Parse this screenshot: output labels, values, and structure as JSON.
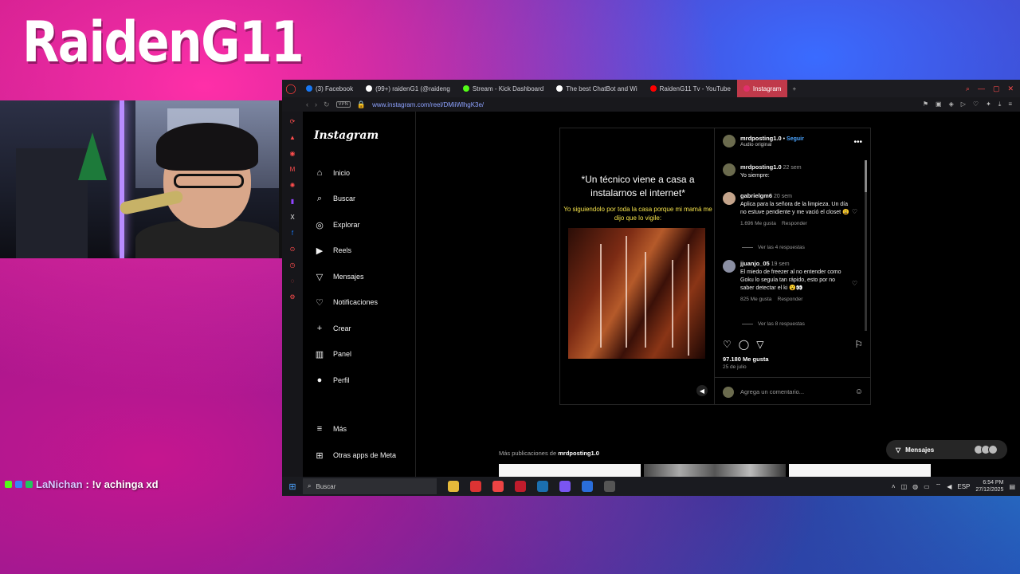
{
  "stream": {
    "title": "RaidenG11",
    "chat": {
      "user": "LaNichan",
      "message": ": !v achinga xd"
    }
  },
  "browser": {
    "tabs": [
      {
        "label": "(3) Facebook",
        "color": "#1877f2"
      },
      {
        "label": "(99+) raidenG1 (@raideng",
        "color": "#ffffff"
      },
      {
        "label": "Stream - Kick Dashboard",
        "color": "#53fc18"
      },
      {
        "label": "The best ChatBot and Wi",
        "color": "#ffffff"
      },
      {
        "label": "RaidenG11 Tv - YouTube",
        "color": "#ff0000"
      },
      {
        "label": "Instagram",
        "color": "#e1306c"
      }
    ],
    "address": {
      "vpn": "VPN",
      "url": "www.instagram.com/reel/DMiiWlhgK3e/"
    }
  },
  "instagram": {
    "logo": "Instagram",
    "nav": [
      {
        "label": "Inicio",
        "icon": "home-icon"
      },
      {
        "label": "Buscar",
        "icon": "search-icon"
      },
      {
        "label": "Explorar",
        "icon": "compass-icon"
      },
      {
        "label": "Reels",
        "icon": "reels-icon"
      },
      {
        "label": "Mensajes",
        "icon": "send-icon"
      },
      {
        "label": "Notificaciones",
        "icon": "heart-icon"
      },
      {
        "label": "Crear",
        "icon": "plus-icon"
      },
      {
        "label": "Panel",
        "icon": "chart-icon"
      },
      {
        "label": "Perfil",
        "icon": "profile-icon"
      }
    ],
    "more": "Más",
    "meta_apps": "Otras apps de Meta",
    "reel": {
      "caption_main": "*Un técnico viene a casa a instalarnos el internet*",
      "caption_sub": "Yo siguiendolo por toda la casa porque mi mamá me dijo que lo vigile:"
    },
    "post": {
      "author": "mrdposting1.0",
      "follow": "Seguir",
      "separator": "•",
      "audio": "Audio original",
      "caption": {
        "user": "mrdposting1.0",
        "time": "22 sem",
        "text": "Yo siempre:"
      },
      "comments": [
        {
          "user": "gabrielgm6",
          "time": "20 sem",
          "text": "Aplica para la señora de la limpieza. Un día no estuve pendiente y me vació el closet 😩",
          "likes": "1.696 Me gusta",
          "reply": "Responder",
          "replies": "Ver las 4 respuestas"
        },
        {
          "user": "jjuanjo_05",
          "time": "19 sem",
          "text": "El miedo de freezer al no entender como Goku lo seguía tan rápido, esto por no saber detectar el ki 😮👀",
          "likes": "825 Me gusta",
          "reply": "Responder",
          "replies": "Ver las 8 respuestas"
        }
      ],
      "likes": "97.180 Me gusta",
      "date": "25 de julio",
      "add_comment_placeholder": "Agrega un comentario..."
    },
    "more_posts_prefix": "Más publicaciones de",
    "more_posts_user": "mrdposting1.0",
    "messages_pill": "Mensajes"
  },
  "taskbar": {
    "search_placeholder": "Buscar",
    "lang": "ESP",
    "time": "6:54 PM",
    "date": "27/12/2025"
  }
}
